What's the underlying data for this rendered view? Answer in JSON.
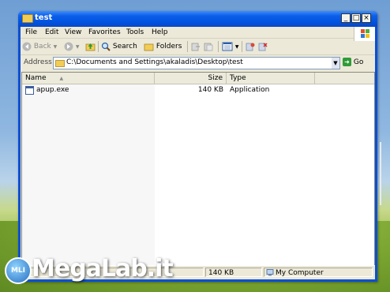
{
  "window": {
    "title": "test",
    "controls": {
      "minimize": "_",
      "maximize": "□",
      "close": "×"
    }
  },
  "menubar": {
    "items": [
      "File",
      "Edit",
      "View",
      "Favorites",
      "Tools",
      "Help"
    ]
  },
  "toolbar": {
    "back_label": "Back",
    "search_label": "Search",
    "folders_label": "Folders"
  },
  "address": {
    "label": "Address",
    "value": "C:\\Documents and Settings\\akaladis\\Desktop\\test",
    "go_label": "Go"
  },
  "listview": {
    "columns": [
      "Name",
      "Size",
      "Type"
    ],
    "rows": [
      {
        "name": "apup.exe",
        "size": "140 KB",
        "type": "Application"
      }
    ]
  },
  "statusbar": {
    "size": "140 KB",
    "zone": "My Computer"
  },
  "watermark": {
    "text": "MegaLab.it",
    "badge": "MLI"
  },
  "colors": {
    "titlebar": "#0053e0",
    "chrome": "#ece9d8",
    "go_button": "#2f9b38"
  }
}
